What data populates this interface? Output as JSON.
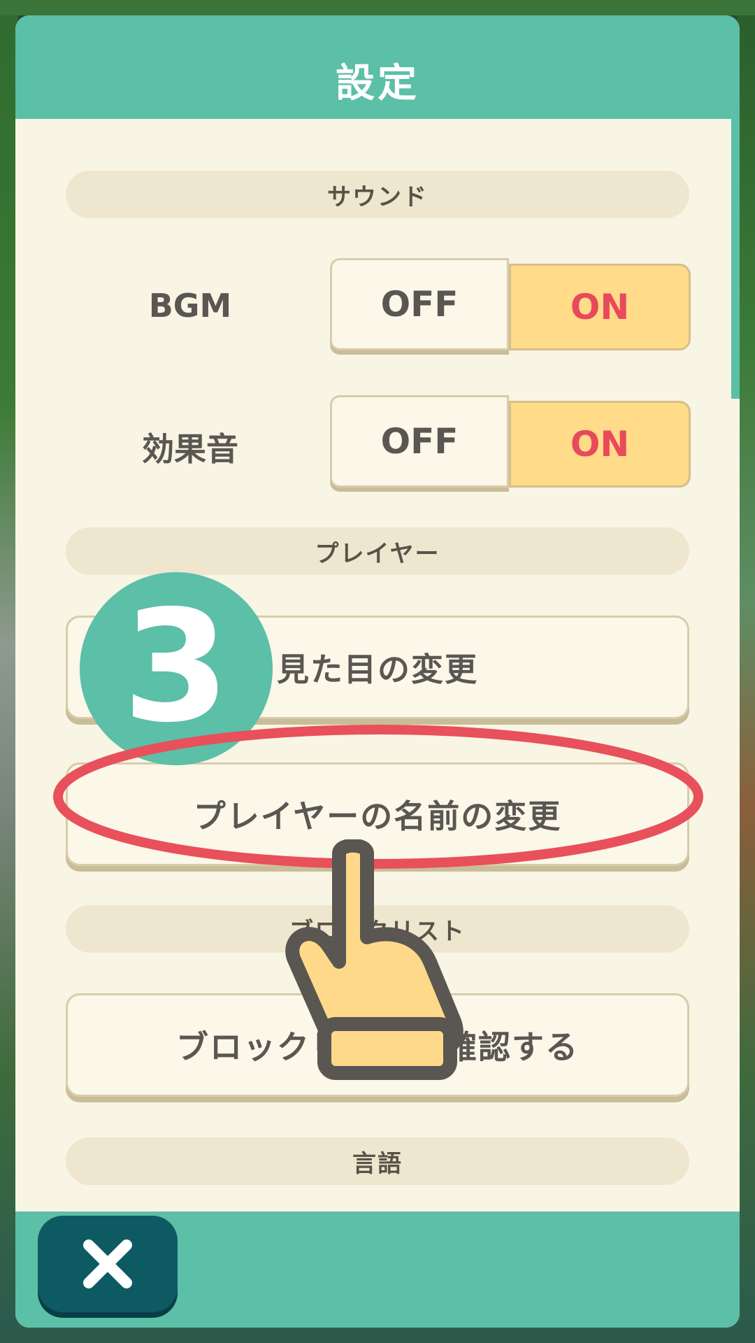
{
  "dialog": {
    "title": "設定",
    "sections": {
      "sound": "サウンド",
      "player": "プレイヤー",
      "block": "ブロックリスト",
      "language": "言語"
    },
    "bgm": {
      "label": "BGM",
      "off": "OFF",
      "on": "ON",
      "selected": "ON"
    },
    "se": {
      "label": "効果音",
      "off": "OFF",
      "on": "ON",
      "selected": "ON"
    },
    "buttons": {
      "appearance": "見た目の変更",
      "rename": "プレイヤーの名前の変更",
      "blocklist": "ブロックリストを確認する"
    },
    "close_icon": "close-icon"
  },
  "overlay": {
    "step_number": "3",
    "highlight_color": "#e8505b",
    "pointer_icon": "pointing-hand-icon"
  },
  "colors": {
    "header": "#5cbfa8",
    "panel": "#f8f5e4",
    "on_fill": "#ffdb8a",
    "on_text": "#e84a5c",
    "close_button": "#0e5a63"
  }
}
